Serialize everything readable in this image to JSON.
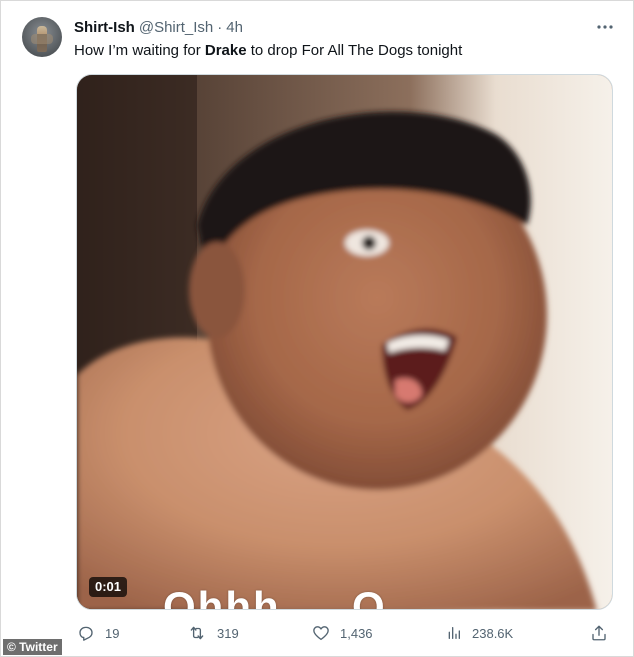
{
  "tweet": {
    "display_name": "Shirt-Ish",
    "handle": "@Shirt_Ish",
    "separator": "·",
    "time": "4h",
    "text_before": "How I’m waiting for ",
    "text_bold": "Drake",
    "text_after": " to drop For All The Dogs tonight",
    "more_icon": "more-horizontal-icon"
  },
  "media": {
    "type": "video",
    "timestamp": "0:01",
    "caption_overlay": "Ohhh … O",
    "colors": {
      "skin": "#c98f6c",
      "hair": "#1e1512",
      "background_wall": "#e8dccd"
    }
  },
  "actions": {
    "reply": {
      "icon": "reply-icon",
      "count": "19"
    },
    "retweet": {
      "icon": "retweet-icon",
      "count": "319"
    },
    "like": {
      "icon": "like-icon",
      "count": "1,436"
    },
    "views": {
      "icon": "views-icon",
      "count": "238.6K"
    },
    "share": {
      "icon": "share-icon"
    }
  },
  "watermark": "© Twitter",
  "colors": {
    "text_primary": "#0f1419",
    "text_secondary": "#536471",
    "border": "#cfd9de"
  }
}
